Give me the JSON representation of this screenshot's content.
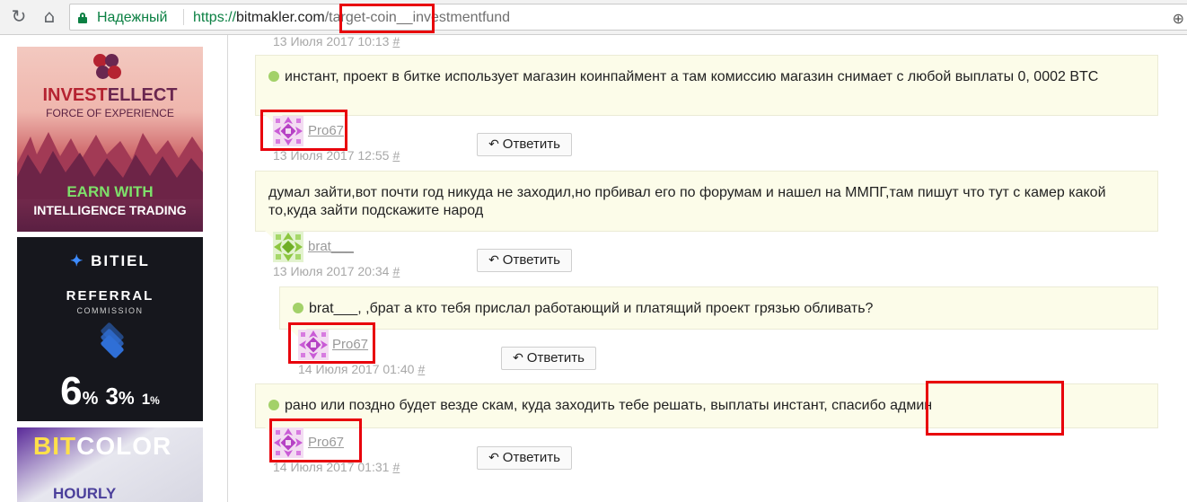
{
  "browser": {
    "security_label": "Надежный",
    "url_scheme": "https://",
    "url_host": "bitmakler.com",
    "url_path": "/target-coin__investmentfund"
  },
  "ads": [
    {
      "brand_part1": "INVEST",
      "brand_part2": "ELLECT",
      "tagline": "FORCE OF EXPERIENCE",
      "cta_line1": "EARN WITH",
      "cta_line2": "INTELLIGENCE TRADING"
    },
    {
      "brand": "BITIEL",
      "line1": "REFERRAL",
      "line2": "COMMISSION",
      "rates": [
        "6",
        "3",
        "1"
      ],
      "percent_sign": "%"
    },
    {
      "brand_part1": "BIT",
      "brand_part2": "COLOR",
      "line1": "HOURLY"
    }
  ],
  "comments": [
    {
      "date": "13 Июля 2017 10:13",
      "permalink": "#"
    },
    {
      "text": "инстант, проект в битке использует магазин коинпаймент а там комиссию магазин снимает с любой выплаты 0, 0002 BTC",
      "author": "Pro67",
      "date": "13 Июля 2017 12:55",
      "permalink": "#",
      "reply_label": "Ответить"
    },
    {
      "text": "думал зайти,вот почти год никуда не заходил,но прбивал его по форумам и нашел на ММПГ,там пишут что тут с камер какой то,куда зайти подскажите народ",
      "author": "brat___",
      "date": "13 Июля 2017 20:34",
      "permalink": "#",
      "reply_label": "Ответить"
    },
    {
      "text": "brat___, ,брат а кто тебя прислал работающий и платящий проект грязью обливать?",
      "author": "Pro67",
      "date": "14 Июля 2017 01:40",
      "permalink": "#",
      "reply_label": "Ответить"
    },
    {
      "text": "рано или поздно будет везде скам, куда заходить тебе решать, выплаты инстант, спасибо админ",
      "author": "Pro67",
      "date": "14 Июля 2017 01:31",
      "permalink": "#",
      "reply_label": "Ответить"
    }
  ],
  "colors": {
    "annotation": "#e8000b",
    "secure": "#0b8043",
    "bubble_bg": "#fcfce9",
    "status_dot": "#a3d169"
  }
}
